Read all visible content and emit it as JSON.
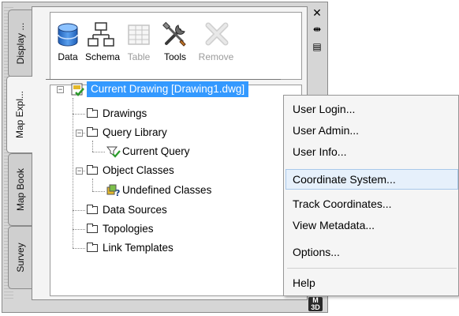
{
  "palette": {
    "tabs": [
      {
        "label": "Display ...",
        "active": false
      },
      {
        "label": "Map Expl...",
        "active": true
      },
      {
        "label": "Map Book",
        "active": false
      },
      {
        "label": "Survey",
        "active": false
      }
    ],
    "side_buttons": [
      "close-icon",
      "pin-icon",
      "properties-icon"
    ]
  },
  "toolbar": {
    "items": [
      {
        "label": "Data",
        "icon": "database-icon",
        "enabled": true
      },
      {
        "label": "Schema",
        "icon": "schema-icon",
        "enabled": true
      },
      {
        "label": "Table",
        "icon": "table-icon",
        "enabled": false
      },
      {
        "label": "Tools",
        "icon": "tools-icon",
        "enabled": true
      },
      {
        "label": "Remove",
        "icon": "remove-icon",
        "enabled": false
      }
    ]
  },
  "tree": {
    "root": {
      "label": "Current Drawing [Drawing1.dwg]",
      "icon": "drawing-icon",
      "selected": true
    },
    "nodes": [
      {
        "label": "Drawings",
        "icon": "folder-icon"
      },
      {
        "label": "Query Library",
        "icon": "folder-icon",
        "expanded": true
      },
      {
        "label": "Current Query",
        "icon": "query-icon"
      },
      {
        "label": "Object Classes",
        "icon": "folder-icon",
        "expanded": true
      },
      {
        "label": "Undefined Classes",
        "icon": "undefined-class-icon"
      },
      {
        "label": "Data Sources",
        "icon": "folder-icon"
      },
      {
        "label": "Topologies",
        "icon": "folder-icon"
      },
      {
        "label": "Link Templates",
        "icon": "folder-icon"
      }
    ]
  },
  "context_menu": {
    "items": [
      {
        "label": "User Login..."
      },
      {
        "label": "User Admin..."
      },
      {
        "label": "User Info..."
      },
      {
        "label": "Coordinate System...",
        "hovered": true
      },
      {
        "label": "Track Coordinates..."
      },
      {
        "label": "View Metadata..."
      },
      {
        "label": "Options..."
      },
      {
        "label": "Help"
      }
    ]
  },
  "corner_icon": {
    "text": "M\n3D"
  },
  "colors": {
    "selection": "#3399ff",
    "menu_hover": "#e6f0fb",
    "frame": "#d6d6d6"
  }
}
